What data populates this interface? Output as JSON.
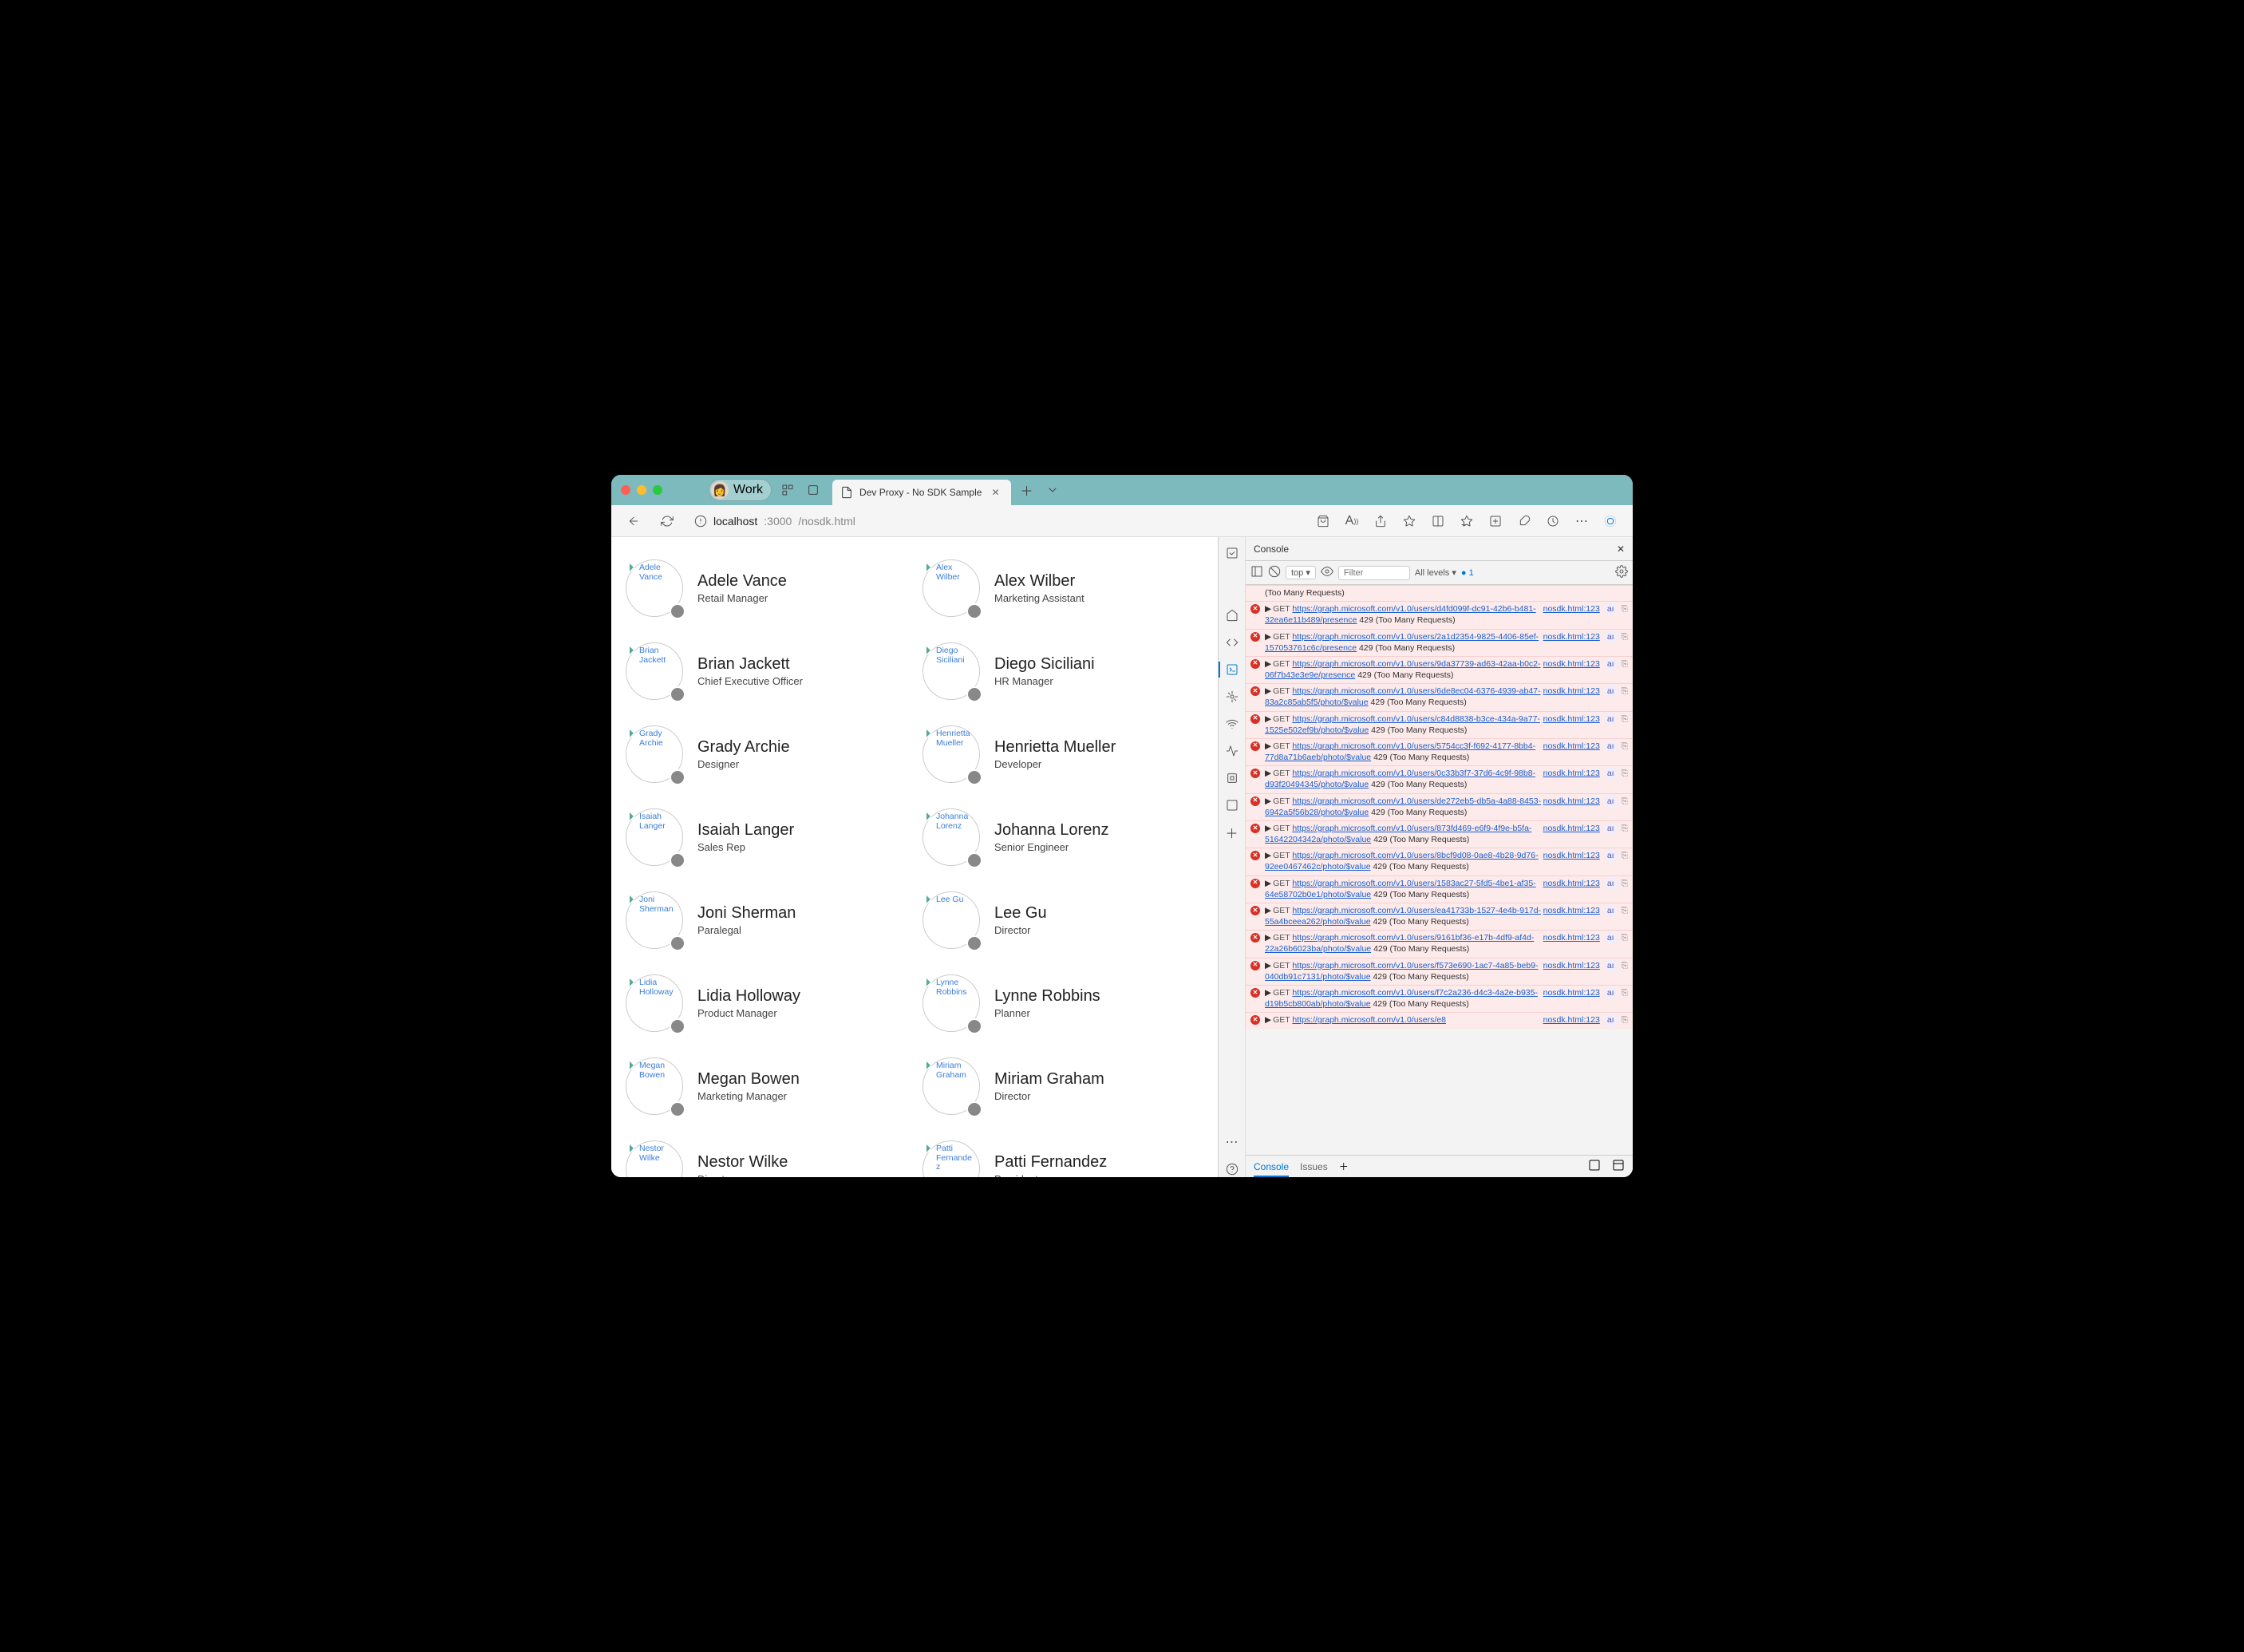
{
  "titlebar": {
    "profile_label": "Work"
  },
  "tab": {
    "title": "Dev Proxy - No SDK Sample"
  },
  "address": {
    "host": "localhost",
    "port": ":3000",
    "path": "/nosdk.html"
  },
  "people": [
    {
      "name": "Adele Vance",
      "title": "Retail Manager",
      "alt": "Adele Vance"
    },
    {
      "name": "Alex Wilber",
      "title": "Marketing Assistant",
      "alt": "Alex Wilber"
    },
    {
      "name": "Brian Jackett",
      "title": "Chief Executive Officer",
      "alt": "Brian Jackett"
    },
    {
      "name": "Diego Siciliani",
      "title": "HR Manager",
      "alt": "Diego Siciliani"
    },
    {
      "name": "Grady Archie",
      "title": "Designer",
      "alt": "Grady Archie"
    },
    {
      "name": "Henrietta Mueller",
      "title": "Developer",
      "alt": "Henrietta Mueller"
    },
    {
      "name": "Isaiah Langer",
      "title": "Sales Rep",
      "alt": "Isaiah Langer"
    },
    {
      "name": "Johanna Lorenz",
      "title": "Senior Engineer",
      "alt": "Johanna Lorenz"
    },
    {
      "name": "Joni Sherman",
      "title": "Paralegal",
      "alt": "Joni Sherman"
    },
    {
      "name": "Lee Gu",
      "title": "Director",
      "alt": "Lee Gu"
    },
    {
      "name": "Lidia Holloway",
      "title": "Product Manager",
      "alt": "Lidia Holloway"
    },
    {
      "name": "Lynne Robbins",
      "title": "Planner",
      "alt": "Lynne Robbins"
    },
    {
      "name": "Megan Bowen",
      "title": "Marketing Manager",
      "alt": "Megan Bowen"
    },
    {
      "name": "Miriam Graham",
      "title": "Director",
      "alt": "Miriam Graham"
    },
    {
      "name": "Nestor Wilke",
      "title": "Director",
      "alt": "Nestor Wilke"
    },
    {
      "name": "Patti Fernandez",
      "title": "President",
      "alt": "Patti Fernandez"
    }
  ],
  "devtools": {
    "header": "Console",
    "context": "top",
    "filter_placeholder": "Filter",
    "levels": "All levels ▾",
    "issues_badge": "1",
    "footer_tabs": {
      "console": "Console",
      "issues": "Issues"
    },
    "logs": [
      {
        "pre": "(Too Many Requests)",
        "url": "",
        "status": "",
        "src": ""
      },
      {
        "url": "https://graph.microsoft.com/v1.0/users/d4fd099f-dc91-42b6-b481-32ea6e11b489/presence",
        "status": "429 (Too Many Requests)",
        "src": "nosdk.html:123"
      },
      {
        "url": "https://graph.microsoft.com/v1.0/users/2a1d2354-9825-4406-85ef-157053761c6c/presence",
        "status": "429 (Too Many Requests)",
        "src": "nosdk.html:123"
      },
      {
        "url": "https://graph.microsoft.com/v1.0/users/9da37739-ad63-42aa-b0c2-06f7b43e3e9e/presence",
        "status": "429 (Too Many Requests)",
        "src": "nosdk.html:123"
      },
      {
        "url": "https://graph.microsoft.com/v1.0/users/6de8ec04-6376-4939-ab47-83a2c85ab5f5/photo/$value",
        "status": "429 (Too Many Requests)",
        "src": "nosdk.html:123"
      },
      {
        "url": "https://graph.microsoft.com/v1.0/users/c84d8838-b3ce-434a-9a77-1525e502ef9b/photo/$value",
        "status": "429 (Too Many Requests)",
        "src": "nosdk.html:123"
      },
      {
        "url": "https://graph.microsoft.com/v1.0/users/5754cc3f-f692-4177-8bb4-77d8a71b6aeb/photo/$value",
        "status": "429 (Too Many Requests)",
        "src": "nosdk.html:123"
      },
      {
        "url": "https://graph.microsoft.com/v1.0/users/0c33b3f7-37d6-4c9f-98b8-d93f20494345/photo/$value",
        "status": "429 (Too Many Requests)",
        "src": "nosdk.html:123"
      },
      {
        "url": "https://graph.microsoft.com/v1.0/users/de272eb5-db5a-4a88-8453-6942a5f56b28/photo/$value",
        "status": "429 (Too Many Requests)",
        "src": "nosdk.html:123"
      },
      {
        "url": "https://graph.microsoft.com/v1.0/users/873fd469-e6f9-4f9e-b5fa-51642204342a/photo/$value",
        "status": "429 (Too Many Requests)",
        "src": "nosdk.html:123"
      },
      {
        "url": "https://graph.microsoft.com/v1.0/users/8bcf9d08-0ae8-4b28-9d76-92ee0467462c/photo/$value",
        "status": "429 (Too Many Requests)",
        "src": "nosdk.html:123"
      },
      {
        "url": "https://graph.microsoft.com/v1.0/users/1583ac27-5fd5-4be1-af35-64e58702b0e1/photo/$value",
        "status": "429 (Too Many Requests)",
        "src": "nosdk.html:123"
      },
      {
        "url": "https://graph.microsoft.com/v1.0/users/ea41733b-1527-4e4b-917d-55a4bceea262/photo/$value",
        "status": "429 (Too Many Requests)",
        "src": "nosdk.html:123"
      },
      {
        "url": "https://graph.microsoft.com/v1.0/users/9161bf36-e17b-4df9-af4d-22a26b6023ba/photo/$value",
        "status": "429 (Too Many Requests)",
        "src": "nosdk.html:123"
      },
      {
        "url": "https://graph.microsoft.com/v1.0/users/f573e690-1ac7-4a85-beb9-040db91c7131/photo/$value",
        "status": "429 (Too Many Requests)",
        "src": "nosdk.html:123"
      },
      {
        "url": "https://graph.microsoft.com/v1.0/users/f7c2a236-d4c3-4a2e-b935-d19b5cb800ab/photo/$value",
        "status": "429 (Too Many Requests)",
        "src": "nosdk.html:123"
      },
      {
        "url": "https://graph.microsoft.com/v1.0/users/e8",
        "status": "",
        "src": "nosdk.html:123"
      }
    ]
  }
}
